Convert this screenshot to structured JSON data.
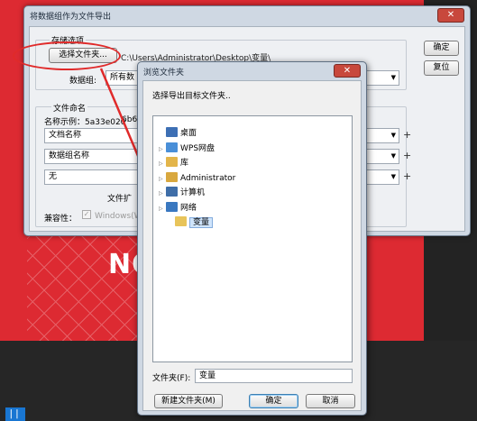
{
  "background": {
    "text": "NO"
  },
  "export_dialog": {
    "title": "将数据组作为文件导出",
    "close_label": "✕",
    "storage_group": "存储选项",
    "choose_folder_label": "选择文件夹...",
    "path_value": "C:\\Users\\Administrator\\Desktop\\变量\\",
    "data_group_label": "数据组:",
    "data_group_value": "所有数",
    "ok_label": "确定",
    "reset_label": "复位",
    "filename_group": "文件命名",
    "name_example_label": "名称示例：5a33e020",
    "name_example_suffix": "6b61",
    "combo1": "文档名称",
    "combo2": "数据组名称",
    "combo3": "无",
    "file_ext_label": "文件扩",
    "compat_label": "兼容性：",
    "windows_label": "Windows(W"
  },
  "browse_dialog": {
    "title": "浏览文件夹",
    "close_label": "✕",
    "prompt": "选择导出目标文件夹..",
    "tree": [
      {
        "label": "桌面",
        "icon": "desktop-icon",
        "color": "#3d6fb4",
        "expander": "",
        "indent": 0,
        "selected": false
      },
      {
        "label": "WPS网盘",
        "icon": "cloud-icon",
        "color": "#4a8fd8",
        "expander": "▷",
        "indent": 0,
        "selected": false
      },
      {
        "label": "库",
        "icon": "library-icon",
        "color": "#e3b54a",
        "expander": "▷",
        "indent": 0,
        "selected": false
      },
      {
        "label": "Administrator",
        "icon": "user-folder-icon",
        "color": "#d9a83e",
        "expander": "▷",
        "indent": 0,
        "selected": false
      },
      {
        "label": "计算机",
        "icon": "computer-icon",
        "color": "#3f6ea8",
        "expander": "▷",
        "indent": 0,
        "selected": false
      },
      {
        "label": "网络",
        "icon": "network-icon",
        "color": "#3a78c0",
        "expander": "▷",
        "indent": 0,
        "selected": false
      },
      {
        "label": "变量",
        "icon": "folder-icon",
        "color": "#e8c45a",
        "expander": "",
        "indent": 1,
        "selected": true
      }
    ],
    "folder_label": "文件夹(F):",
    "folder_value": "变量",
    "new_folder_label": "新建文件夹(M)",
    "ok_label": "确定",
    "cancel_label": "取消"
  },
  "colors": {
    "accent_red": "#dd2a32",
    "callout_red": "#e02a2a",
    "selection": "#cfe4fb"
  }
}
